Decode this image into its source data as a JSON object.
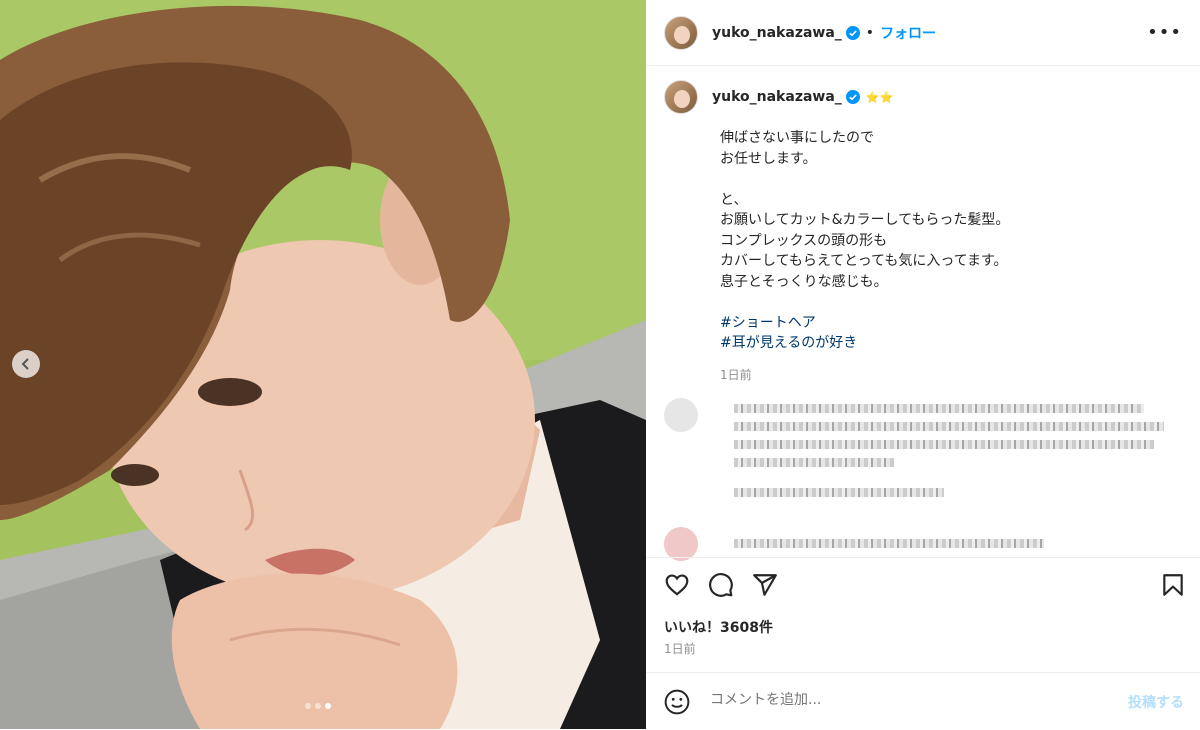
{
  "header": {
    "username": "yuko_nakazawa_",
    "separator": "•",
    "follow_label": "フォロー",
    "more_label": "•••"
  },
  "caption": {
    "username": "yuko_nakazawa_",
    "stars": "⭐⭐",
    "lines": [
      "伸ばさない事にしたので",
      "お任せします。",
      "",
      "と、",
      "お願いしてカット&カラーしてもらった髪型。",
      "コンプレックスの頭の形も",
      "カバーしてもらえてとっても気に入ってます。",
      "息子とそっくりな感じも。"
    ],
    "hashtags": [
      "#ショートヘア",
      "#耳が見えるのが好き"
    ],
    "time": "1日前"
  },
  "actions": {
    "like_icon": "heart-icon",
    "comment_icon": "comment-icon",
    "share_icon": "paper-plane-icon",
    "save_icon": "bookmark-icon"
  },
  "likes_text": "いいね！3608件",
  "post_time": "1日前",
  "comment_input": {
    "placeholder": "コメントを追加...",
    "post_label": "投稿する"
  },
  "colors": {
    "accent": "#0095f6",
    "text": "#262626",
    "muted": "#8e8e8e",
    "hashtag": "#00376b"
  }
}
